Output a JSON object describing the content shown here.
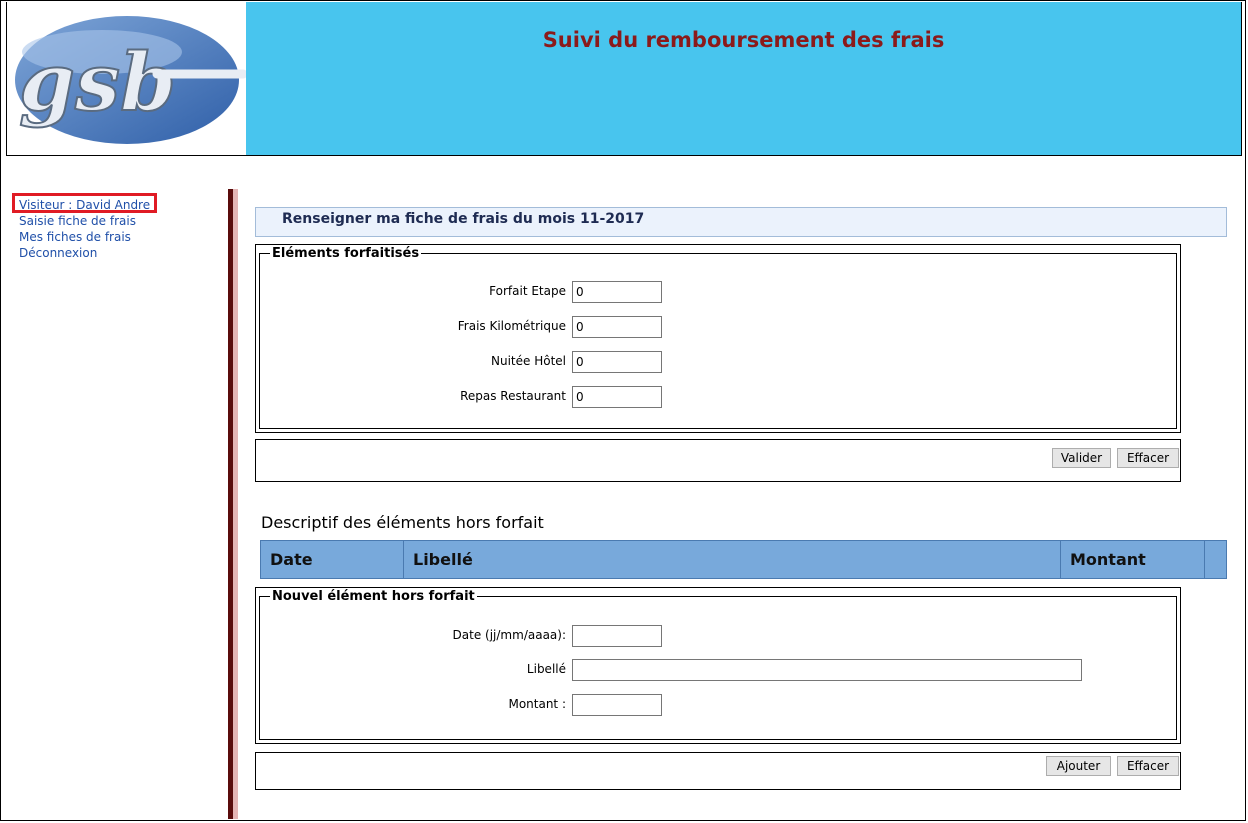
{
  "header": {
    "title": "Suivi du remboursement des frais",
    "logo_text": "gsb"
  },
  "menu": {
    "visitor": "Visiteur : David Andre",
    "items": [
      {
        "label": "Saisie fiche de frais"
      },
      {
        "label": "Mes fiches de frais"
      },
      {
        "label": "Déconnexion"
      }
    ]
  },
  "page_title": "Renseigner ma fiche de frais du mois 11-2017",
  "forfait": {
    "legend": "Eléments forfaitisés",
    "fields": [
      {
        "label": "Forfait Etape",
        "value": "0"
      },
      {
        "label": "Frais Kilométrique",
        "value": "0"
      },
      {
        "label": "Nuitée Hôtel",
        "value": "0"
      },
      {
        "label": "Repas Restaurant",
        "value": "0"
      }
    ],
    "validate_label": "Valider",
    "clear_label": "Effacer"
  },
  "hors_forfait": {
    "heading": "Descriptif des éléments hors forfait",
    "columns": [
      "Date",
      "Libellé",
      "Montant"
    ]
  },
  "new_element": {
    "legend": "Nouvel élément hors forfait",
    "date_label": "Date (jj/mm/aaaa):",
    "libelle_label": "Libellé",
    "montant_label": "Montant :",
    "date_value": "",
    "libelle_value": "",
    "montant_value": "",
    "add_label": "Ajouter",
    "clear_label": "Effacer"
  },
  "colors": {
    "header_bg": "#48c5ee",
    "title_color": "#8b1a1a",
    "menu_link": "#1f4fa8",
    "highlight": "#e01b24",
    "table_head": "#78a9db"
  }
}
